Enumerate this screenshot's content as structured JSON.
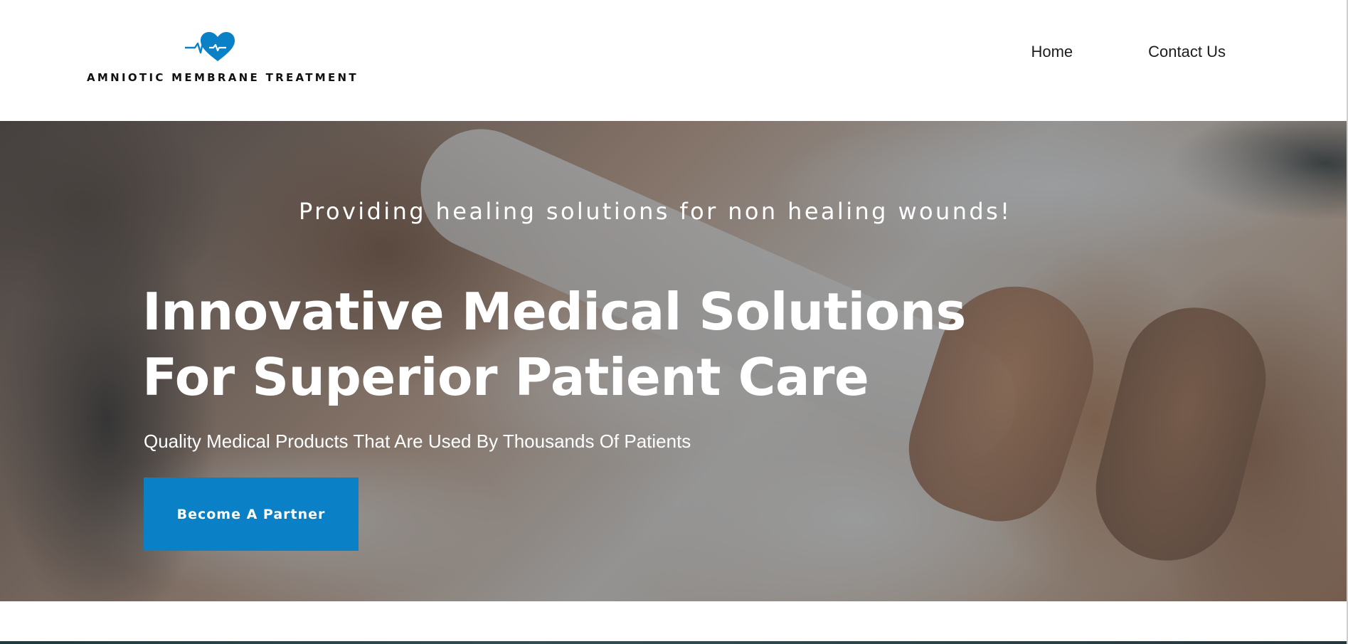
{
  "header": {
    "logo_text": "AMNIOTIC MEMBRANE TREATMENT",
    "logo_icon": "heart-pulse-icon",
    "nav": [
      {
        "label": "Home"
      },
      {
        "label": "Contact Us"
      }
    ]
  },
  "hero": {
    "tagline": "Providing healing solutions for non healing wounds!",
    "headline": "Innovative Medical Solutions For Superior Patient Care",
    "subheadline": "Quality Medical Products That Are Used By Thousands Of Patients",
    "cta_label": "Become A Partner"
  },
  "colors": {
    "brand_blue": "#0a81c7",
    "text_dark": "#1c1c1c",
    "overlay": "#4e5256"
  }
}
